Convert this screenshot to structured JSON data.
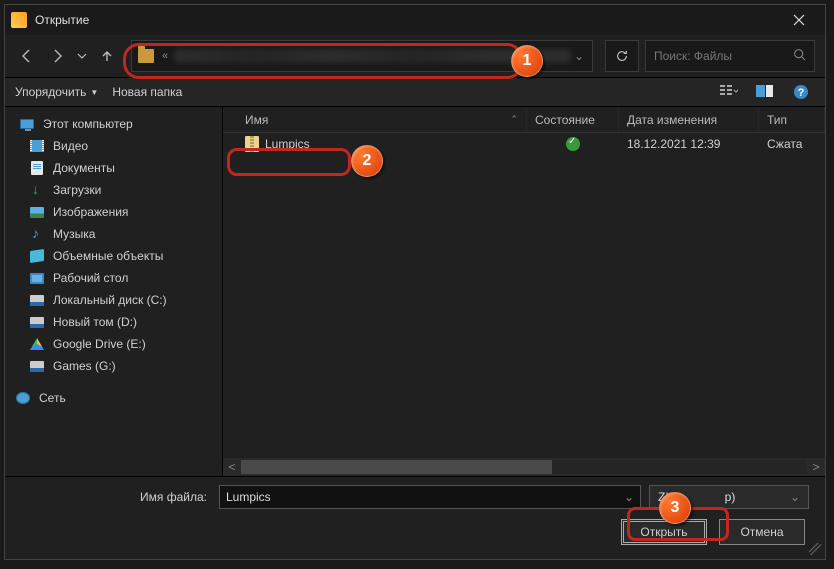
{
  "titlebar": {
    "title": "Открытие"
  },
  "nav": {
    "search_placeholder": "Поиск: Файлы"
  },
  "toolbar": {
    "organize": "Упорядочить",
    "new_folder": "Новая папка"
  },
  "sidebar": {
    "this_pc": "Этот компьютер",
    "items": [
      "Видео",
      "Документы",
      "Загрузки",
      "Изображения",
      "Музыка",
      "Объемные объекты",
      "Рабочий стол",
      "Локальный диск (C:)",
      "Новый том (D:)",
      "Google Drive (E:)",
      "Games (G:)"
    ],
    "network": "Сеть"
  },
  "columns": {
    "name": "Имя",
    "status": "Состояние",
    "date": "Дата изменения",
    "type": "Тип"
  },
  "files": [
    {
      "name": "Lumpics",
      "status": "ok",
      "date": "18.12.2021 12:39",
      "type": "Сжата"
    }
  ],
  "bottom": {
    "filename_label": "Имя файла:",
    "filename_value": "Lumpics",
    "filetype_prefix": "ZIP",
    "filetype_suffix": "p)",
    "open": "Открыть",
    "cancel": "Отмена"
  },
  "badges": {
    "b1": "1",
    "b2": "2",
    "b3": "3"
  }
}
